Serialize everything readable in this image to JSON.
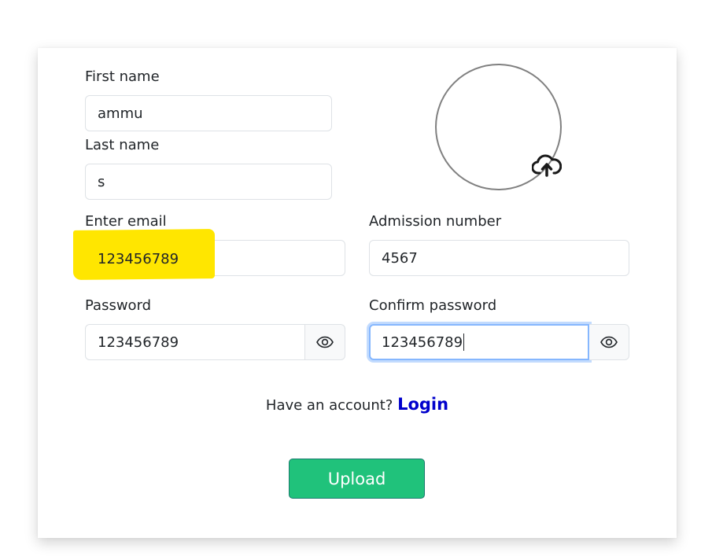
{
  "form": {
    "first_name": {
      "label": "First name",
      "value": "ammu"
    },
    "last_name": {
      "label": "Last name",
      "value": "s"
    },
    "email": {
      "label": "Enter email",
      "value": "123456789"
    },
    "admission_number": {
      "label": "Admission number",
      "value": "4567"
    },
    "password": {
      "label": "Password",
      "value": "123456789"
    },
    "confirm_password": {
      "label": "Confirm password",
      "value": "123456789"
    }
  },
  "avatar": {
    "upload_icon": "cloud-upload-icon"
  },
  "toggle_icon": "eye-icon",
  "account_prompt": {
    "text": "Have an account?",
    "link": "Login"
  },
  "upload_button": {
    "label": "Upload"
  },
  "colors": {
    "highlight": "#ffe600",
    "button": "#20c27b",
    "link": "#0000cc",
    "focus_border": "#86b7fe"
  }
}
